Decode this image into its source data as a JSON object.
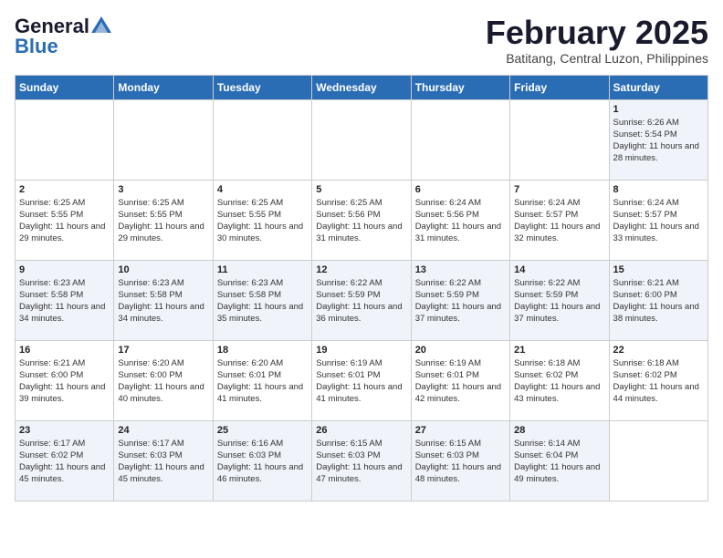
{
  "logo": {
    "general": "General",
    "blue": "Blue"
  },
  "title": "February 2025",
  "subtitle": "Batitang, Central Luzon, Philippines",
  "days_of_week": [
    "Sunday",
    "Monday",
    "Tuesday",
    "Wednesday",
    "Thursday",
    "Friday",
    "Saturday"
  ],
  "weeks": [
    [
      {
        "day": "",
        "info": ""
      },
      {
        "day": "",
        "info": ""
      },
      {
        "day": "",
        "info": ""
      },
      {
        "day": "",
        "info": ""
      },
      {
        "day": "",
        "info": ""
      },
      {
        "day": "",
        "info": ""
      },
      {
        "day": "1",
        "info": "Sunrise: 6:26 AM\nSunset: 5:54 PM\nDaylight: 11 hours and 28 minutes."
      }
    ],
    [
      {
        "day": "2",
        "info": "Sunrise: 6:25 AM\nSunset: 5:55 PM\nDaylight: 11 hours and 29 minutes."
      },
      {
        "day": "3",
        "info": "Sunrise: 6:25 AM\nSunset: 5:55 PM\nDaylight: 11 hours and 29 minutes."
      },
      {
        "day": "4",
        "info": "Sunrise: 6:25 AM\nSunset: 5:55 PM\nDaylight: 11 hours and 30 minutes."
      },
      {
        "day": "5",
        "info": "Sunrise: 6:25 AM\nSunset: 5:56 PM\nDaylight: 11 hours and 31 minutes."
      },
      {
        "day": "6",
        "info": "Sunrise: 6:24 AM\nSunset: 5:56 PM\nDaylight: 11 hours and 31 minutes."
      },
      {
        "day": "7",
        "info": "Sunrise: 6:24 AM\nSunset: 5:57 PM\nDaylight: 11 hours and 32 minutes."
      },
      {
        "day": "8",
        "info": "Sunrise: 6:24 AM\nSunset: 5:57 PM\nDaylight: 11 hours and 33 minutes."
      }
    ],
    [
      {
        "day": "9",
        "info": "Sunrise: 6:23 AM\nSunset: 5:58 PM\nDaylight: 11 hours and 34 minutes."
      },
      {
        "day": "10",
        "info": "Sunrise: 6:23 AM\nSunset: 5:58 PM\nDaylight: 11 hours and 34 minutes."
      },
      {
        "day": "11",
        "info": "Sunrise: 6:23 AM\nSunset: 5:58 PM\nDaylight: 11 hours and 35 minutes."
      },
      {
        "day": "12",
        "info": "Sunrise: 6:22 AM\nSunset: 5:59 PM\nDaylight: 11 hours and 36 minutes."
      },
      {
        "day": "13",
        "info": "Sunrise: 6:22 AM\nSunset: 5:59 PM\nDaylight: 11 hours and 37 minutes."
      },
      {
        "day": "14",
        "info": "Sunrise: 6:22 AM\nSunset: 5:59 PM\nDaylight: 11 hours and 37 minutes."
      },
      {
        "day": "15",
        "info": "Sunrise: 6:21 AM\nSunset: 6:00 PM\nDaylight: 11 hours and 38 minutes."
      }
    ],
    [
      {
        "day": "16",
        "info": "Sunrise: 6:21 AM\nSunset: 6:00 PM\nDaylight: 11 hours and 39 minutes."
      },
      {
        "day": "17",
        "info": "Sunrise: 6:20 AM\nSunset: 6:00 PM\nDaylight: 11 hours and 40 minutes."
      },
      {
        "day": "18",
        "info": "Sunrise: 6:20 AM\nSunset: 6:01 PM\nDaylight: 11 hours and 41 minutes."
      },
      {
        "day": "19",
        "info": "Sunrise: 6:19 AM\nSunset: 6:01 PM\nDaylight: 11 hours and 41 minutes."
      },
      {
        "day": "20",
        "info": "Sunrise: 6:19 AM\nSunset: 6:01 PM\nDaylight: 11 hours and 42 minutes."
      },
      {
        "day": "21",
        "info": "Sunrise: 6:18 AM\nSunset: 6:02 PM\nDaylight: 11 hours and 43 minutes."
      },
      {
        "day": "22",
        "info": "Sunrise: 6:18 AM\nSunset: 6:02 PM\nDaylight: 11 hours and 44 minutes."
      }
    ],
    [
      {
        "day": "23",
        "info": "Sunrise: 6:17 AM\nSunset: 6:02 PM\nDaylight: 11 hours and 45 minutes."
      },
      {
        "day": "24",
        "info": "Sunrise: 6:17 AM\nSunset: 6:03 PM\nDaylight: 11 hours and 45 minutes."
      },
      {
        "day": "25",
        "info": "Sunrise: 6:16 AM\nSunset: 6:03 PM\nDaylight: 11 hours and 46 minutes."
      },
      {
        "day": "26",
        "info": "Sunrise: 6:15 AM\nSunset: 6:03 PM\nDaylight: 11 hours and 47 minutes."
      },
      {
        "day": "27",
        "info": "Sunrise: 6:15 AM\nSunset: 6:03 PM\nDaylight: 11 hours and 48 minutes."
      },
      {
        "day": "28",
        "info": "Sunrise: 6:14 AM\nSunset: 6:04 PM\nDaylight: 11 hours and 49 minutes."
      },
      {
        "day": "",
        "info": ""
      }
    ]
  ]
}
